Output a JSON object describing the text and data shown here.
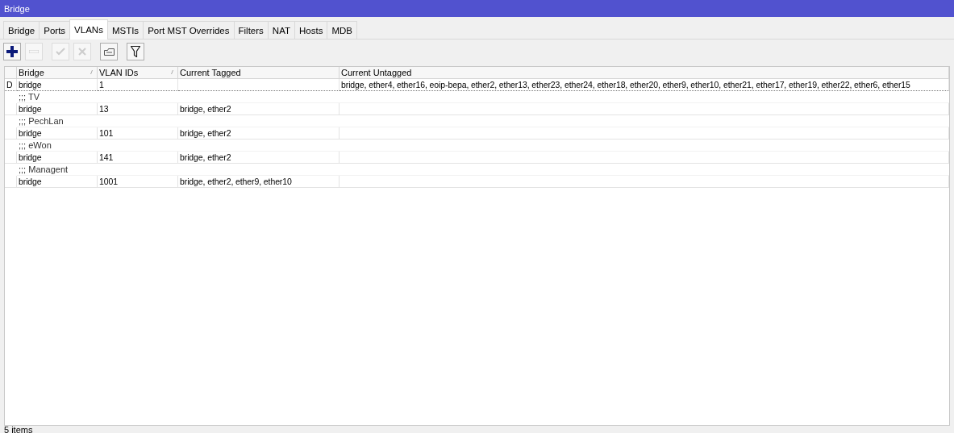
{
  "window": {
    "title": "Bridge"
  },
  "tabs": [
    {
      "label": "Bridge",
      "selected": false
    },
    {
      "label": "Ports",
      "selected": false
    },
    {
      "label": "VLANs",
      "selected": true
    },
    {
      "label": "MSTIs",
      "selected": false
    },
    {
      "label": "Port MST Overrides",
      "selected": false
    },
    {
      "label": "Filters",
      "selected": false
    },
    {
      "label": "NAT",
      "selected": false
    },
    {
      "label": "Hosts",
      "selected": false
    },
    {
      "label": "MDB",
      "selected": false
    }
  ],
  "toolbar": [
    {
      "kind": "add",
      "disabled": false
    },
    {
      "kind": "remove",
      "disabled": true
    },
    {
      "kind": "enable",
      "disabled": true
    },
    {
      "kind": "disable",
      "disabled": true
    },
    {
      "kind": "comment",
      "disabled": false
    },
    {
      "kind": "filter",
      "disabled": false
    }
  ],
  "table": {
    "columns": [
      "Bridge",
      "VLAN IDs",
      "Current Tagged",
      "Current Untagged"
    ],
    "rows": [
      {
        "kind": "item",
        "selected": true,
        "flag": "D",
        "cells": [
          "bridge",
          "1",
          "",
          "bridge, ether4, ether16, eoip-bepa, ether2, ether13, ether23, ether24, ether18, ether20, ether9, ether10, ether21, ether17, ether19, ether22, ether6, ether15"
        ]
      },
      {
        "kind": "comment",
        "text": ";;; TV"
      },
      {
        "kind": "item",
        "selected": false,
        "cells": [
          "bridge",
          "13",
          "bridge, ether2",
          ""
        ]
      },
      {
        "kind": "comment",
        "text": ";;; PechLan"
      },
      {
        "kind": "item",
        "selected": false,
        "cells": [
          "bridge",
          "101",
          "bridge, ether2",
          ""
        ]
      },
      {
        "kind": "comment",
        "text": ";;; eWon"
      },
      {
        "kind": "item",
        "selected": false,
        "cells": [
          "bridge",
          "141",
          "bridge, ether2",
          ""
        ]
      },
      {
        "kind": "comment",
        "text": ";;; Managent"
      },
      {
        "kind": "item",
        "selected": false,
        "cells": [
          "bridge",
          "1001",
          "bridge, ether2, ether9, ether10",
          ""
        ]
      }
    ]
  },
  "status_bar": "5 items"
}
